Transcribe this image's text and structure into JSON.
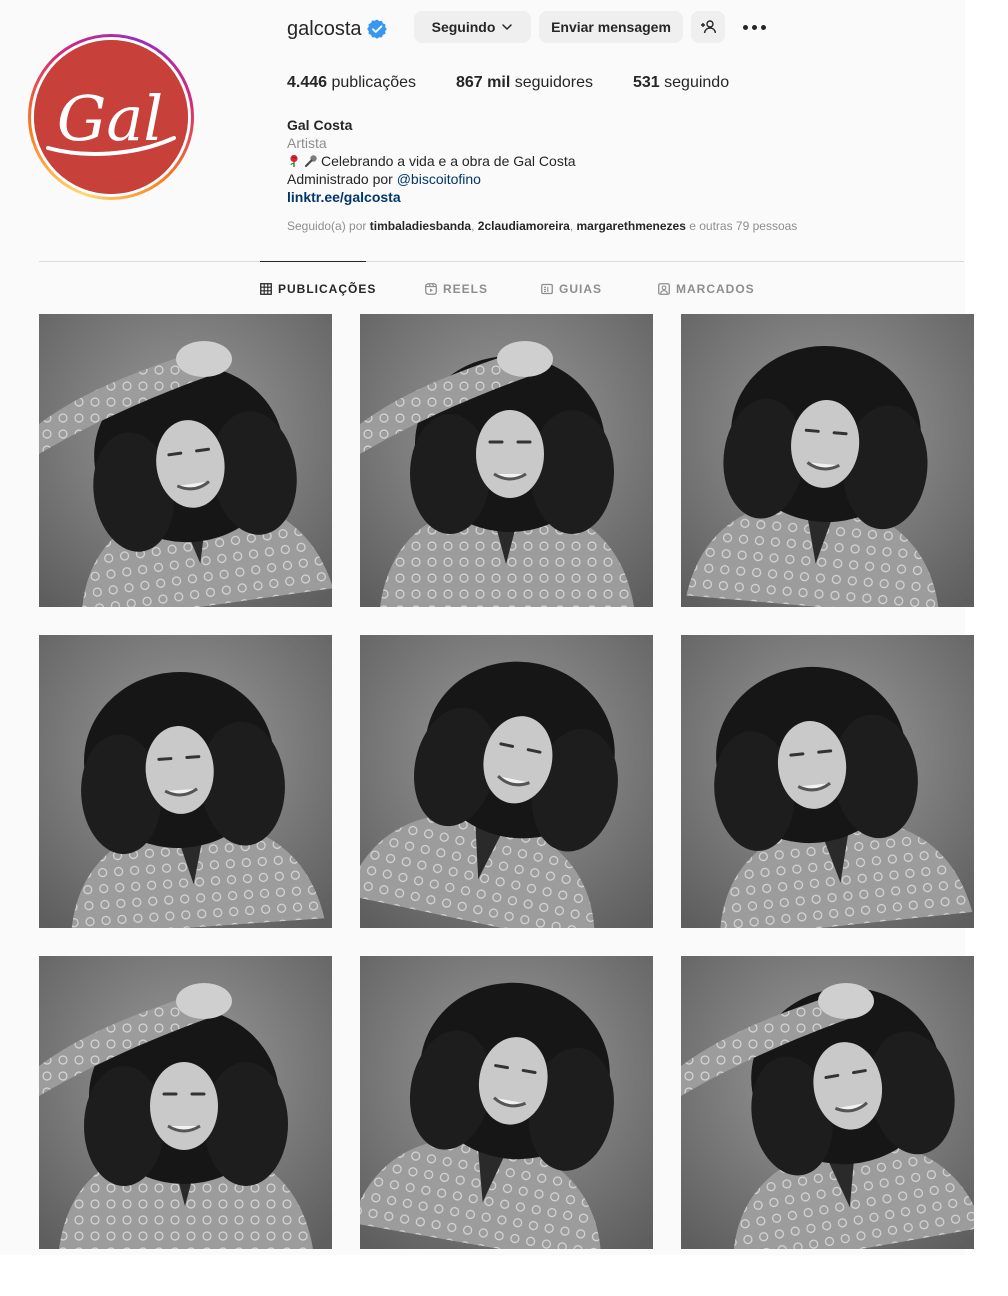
{
  "profile": {
    "username": "galcosta",
    "avatar_text": "Gal",
    "buttons": {
      "following": "Seguindo",
      "message": "Enviar mensagem"
    },
    "stats": [
      {
        "value": "4.446",
        "label": "publicações"
      },
      {
        "value": "867 mil",
        "label": "seguidores"
      },
      {
        "value": "531",
        "label": "seguindo"
      }
    ],
    "full_name": "Gal Costa",
    "category": "Artista",
    "bio_line": "Celebrando a vida e a obra de Gal Costa",
    "bio_emojis": [
      "rose",
      "microphone"
    ],
    "admin_prefix": "Administrado por",
    "admin_handle": "@biscoitofino",
    "link": "linktr.ee/galcosta",
    "followed_by": {
      "prefix": "Seguido(a) por",
      "users": [
        "timbaladiesbanda",
        "2claudiamoreira",
        "margarethmenezes"
      ],
      "suffix": "e outras 79 pessoas"
    }
  },
  "tabs": [
    {
      "label": "PUBLICAÇÕES",
      "icon": "grid-icon",
      "active": true
    },
    {
      "label": "REELS",
      "icon": "reels-icon",
      "active": false
    },
    {
      "label": "GUIAS",
      "icon": "guides-icon",
      "active": false
    },
    {
      "label": "MARCADOS",
      "icon": "tagged-icon",
      "active": false
    }
  ],
  "posts": [
    {
      "description": "black and white portrait, hand on head"
    },
    {
      "description": "black and white portrait, eyes closed, arm over forehead"
    },
    {
      "description": "black and white portrait, smiling, hair flying"
    },
    {
      "description": "black and white portrait, curly hair spread"
    },
    {
      "description": "black and white portrait, head tilted laughing"
    },
    {
      "description": "black and white portrait, hair in motion"
    },
    {
      "description": "black and white portrait, hands framing face"
    },
    {
      "description": "black and white portrait, hair swinging"
    },
    {
      "description": "black and white portrait, hand raised"
    }
  ],
  "colors": {
    "avatar_bg": "#c8403a",
    "link": "#00376b",
    "verified": "#3897f0",
    "muted": "#8e8e8e"
  }
}
